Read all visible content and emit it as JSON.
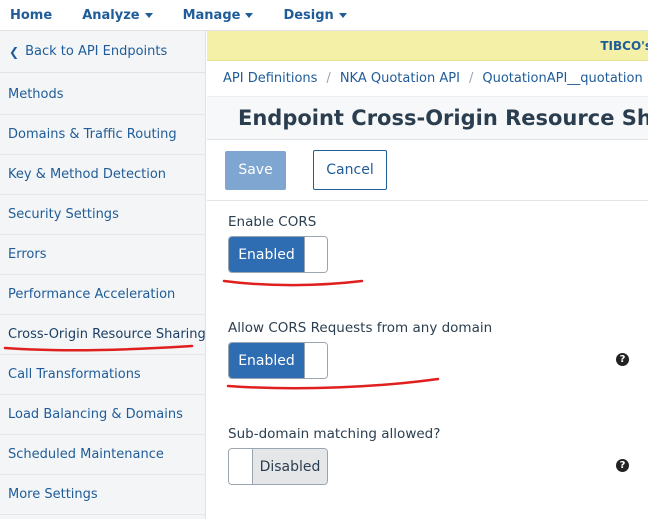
{
  "topnav": {
    "home": "Home",
    "analyze": "Analyze",
    "manage": "Manage",
    "design": "Design"
  },
  "sidebar": {
    "back": "Back to API Endpoints",
    "items": [
      {
        "label": "Methods"
      },
      {
        "label": "Domains & Traffic Routing"
      },
      {
        "label": "Key & Method Detection"
      },
      {
        "label": "Security Settings"
      },
      {
        "label": "Errors"
      },
      {
        "label": "Performance Acceleration"
      },
      {
        "label": "Cross-Origin Resource Sharing",
        "active": true
      },
      {
        "label": "Call Transformations"
      },
      {
        "label": "Load Balancing & Domains"
      },
      {
        "label": "Scheduled Maintenance"
      },
      {
        "label": "More Settings"
      }
    ]
  },
  "banner": {
    "text": "TIBCO's"
  },
  "breadcrumb": [
    "API Definitions",
    "NKA Quotation API",
    "QuotationAPI__quotation"
  ],
  "page": {
    "title": "Endpoint Cross-Origin Resource Sharing"
  },
  "actions": {
    "save": "Save",
    "cancel": "Cancel"
  },
  "fields": {
    "enable_cors": {
      "label": "Enable CORS",
      "state": "Enabled"
    },
    "allow_any": {
      "label": "Allow CORS Requests from any domain",
      "state": "Enabled"
    },
    "subdomain": {
      "label": "Sub-domain matching allowed?",
      "state": "Disabled"
    }
  },
  "help": {
    "glyph": "?"
  },
  "colors": {
    "accent": "#1f5c99",
    "toggle_on": "#2f6db3",
    "banner": "#f5f0a8",
    "annotation": "#e0201f"
  }
}
